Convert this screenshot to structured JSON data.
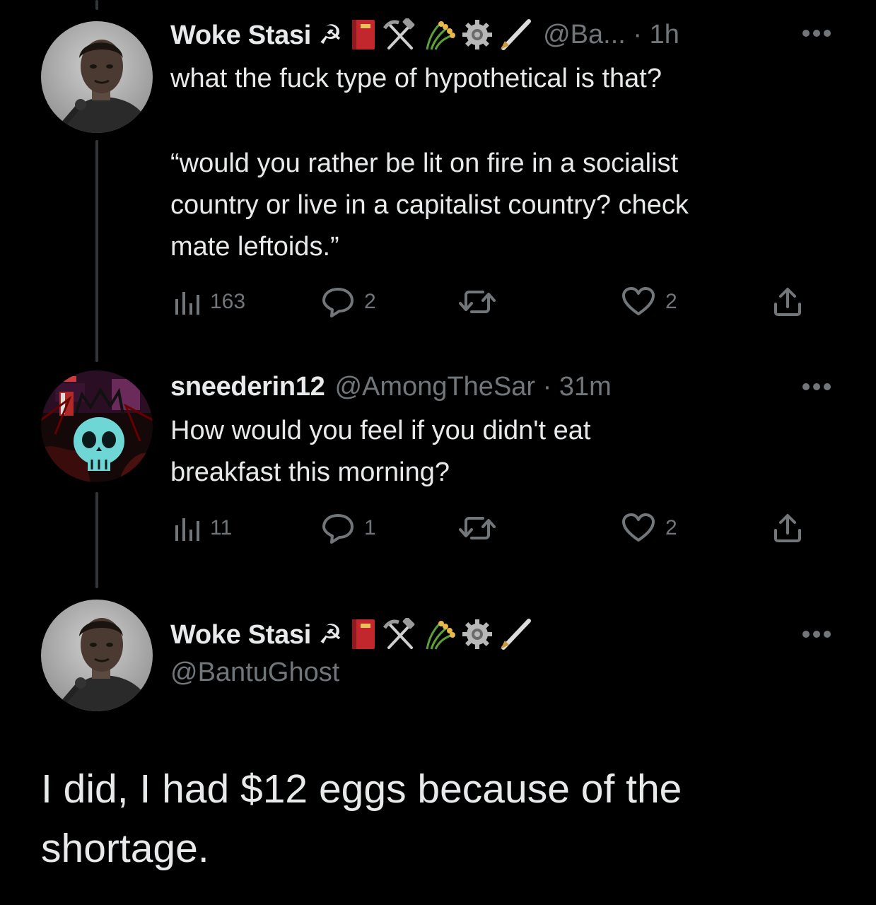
{
  "tweet1": {
    "display_name": "Woke Stasi ☭",
    "meta": "@Ba... · 1h",
    "text_line1": "what the fuck type of hypothetical is that?",
    "text_quote": "“would you rather be lit on fire in a socialist\ncountry or live in a capitalist country? check\nmate leftoids.”",
    "views": "163",
    "replies": "2",
    "retweets": "",
    "likes": "2"
  },
  "tweet2": {
    "display_name": "sneederin12",
    "meta": "@AmongTheSar · 31m",
    "text": "How would you feel if you didn't eat\nbreakfast this morning?",
    "views": "11",
    "replies": "1",
    "retweets": "",
    "likes": "2"
  },
  "tweet3": {
    "display_name": "Woke Stasi ☭",
    "handle": "@BantuGhost",
    "text": "I did, I had $12 eggs because of the\nshortage."
  },
  "icons": {
    "views": "bar-chart-icon",
    "reply": "speech-bubble-icon",
    "retweet": "retweet-arrows-icon",
    "like": "heart-icon",
    "share": "share-upload-icon",
    "more": "more-dots-icon",
    "name_emojis": [
      "red-book-emoji",
      "hammer-and-pick-emoji",
      "sheaf-of-rice-emoji",
      "gear-emoji",
      "fountain-pen-emoji"
    ]
  },
  "colors": {
    "background": "#000000",
    "primary_text": "#e7e9ea",
    "secondary_text": "#71767b",
    "thread_line": "#333639"
  }
}
